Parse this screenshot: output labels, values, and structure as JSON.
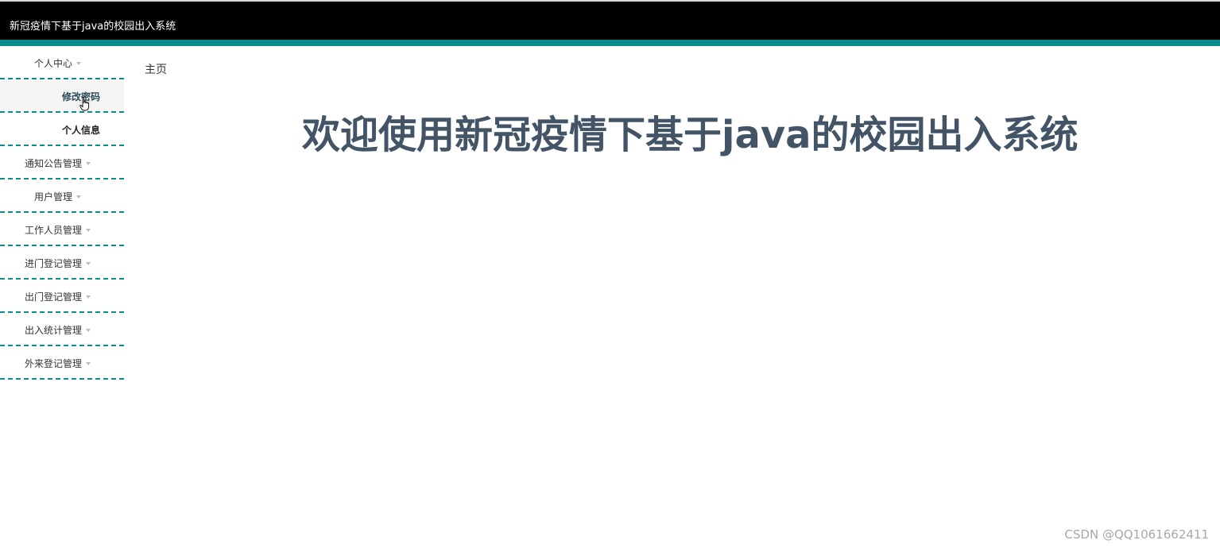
{
  "header": {
    "title": "新冠疫情下基于java的校园出入系统"
  },
  "colors": {
    "header_bg": "#000000",
    "accent": "#0a8c8c",
    "welcome_text": "#435466"
  },
  "sidebar": {
    "personal_center": {
      "label": "个人中心",
      "icon": "caret-down-icon",
      "subitems": [
        {
          "label": "修改密码",
          "active": true
        },
        {
          "label": "个人信息",
          "active": false
        }
      ]
    },
    "items": [
      {
        "label": "通知公告管理",
        "icon": "caret-down-icon"
      },
      {
        "label": "用户管理",
        "icon": "caret-down-icon"
      },
      {
        "label": "工作人员管理",
        "icon": "caret-down-icon"
      },
      {
        "label": "进门登记管理",
        "icon": "caret-down-icon"
      },
      {
        "label": "出门登记管理",
        "icon": "caret-down-icon"
      },
      {
        "label": "出入统计管理",
        "icon": "caret-down-icon"
      },
      {
        "label": "外来登记管理",
        "icon": "caret-down-icon"
      }
    ]
  },
  "main": {
    "breadcrumb": "主页",
    "welcome": "欢迎使用新冠疫情下基于java的校园出入系统"
  },
  "watermark": "CSDN @QQ1061662411"
}
